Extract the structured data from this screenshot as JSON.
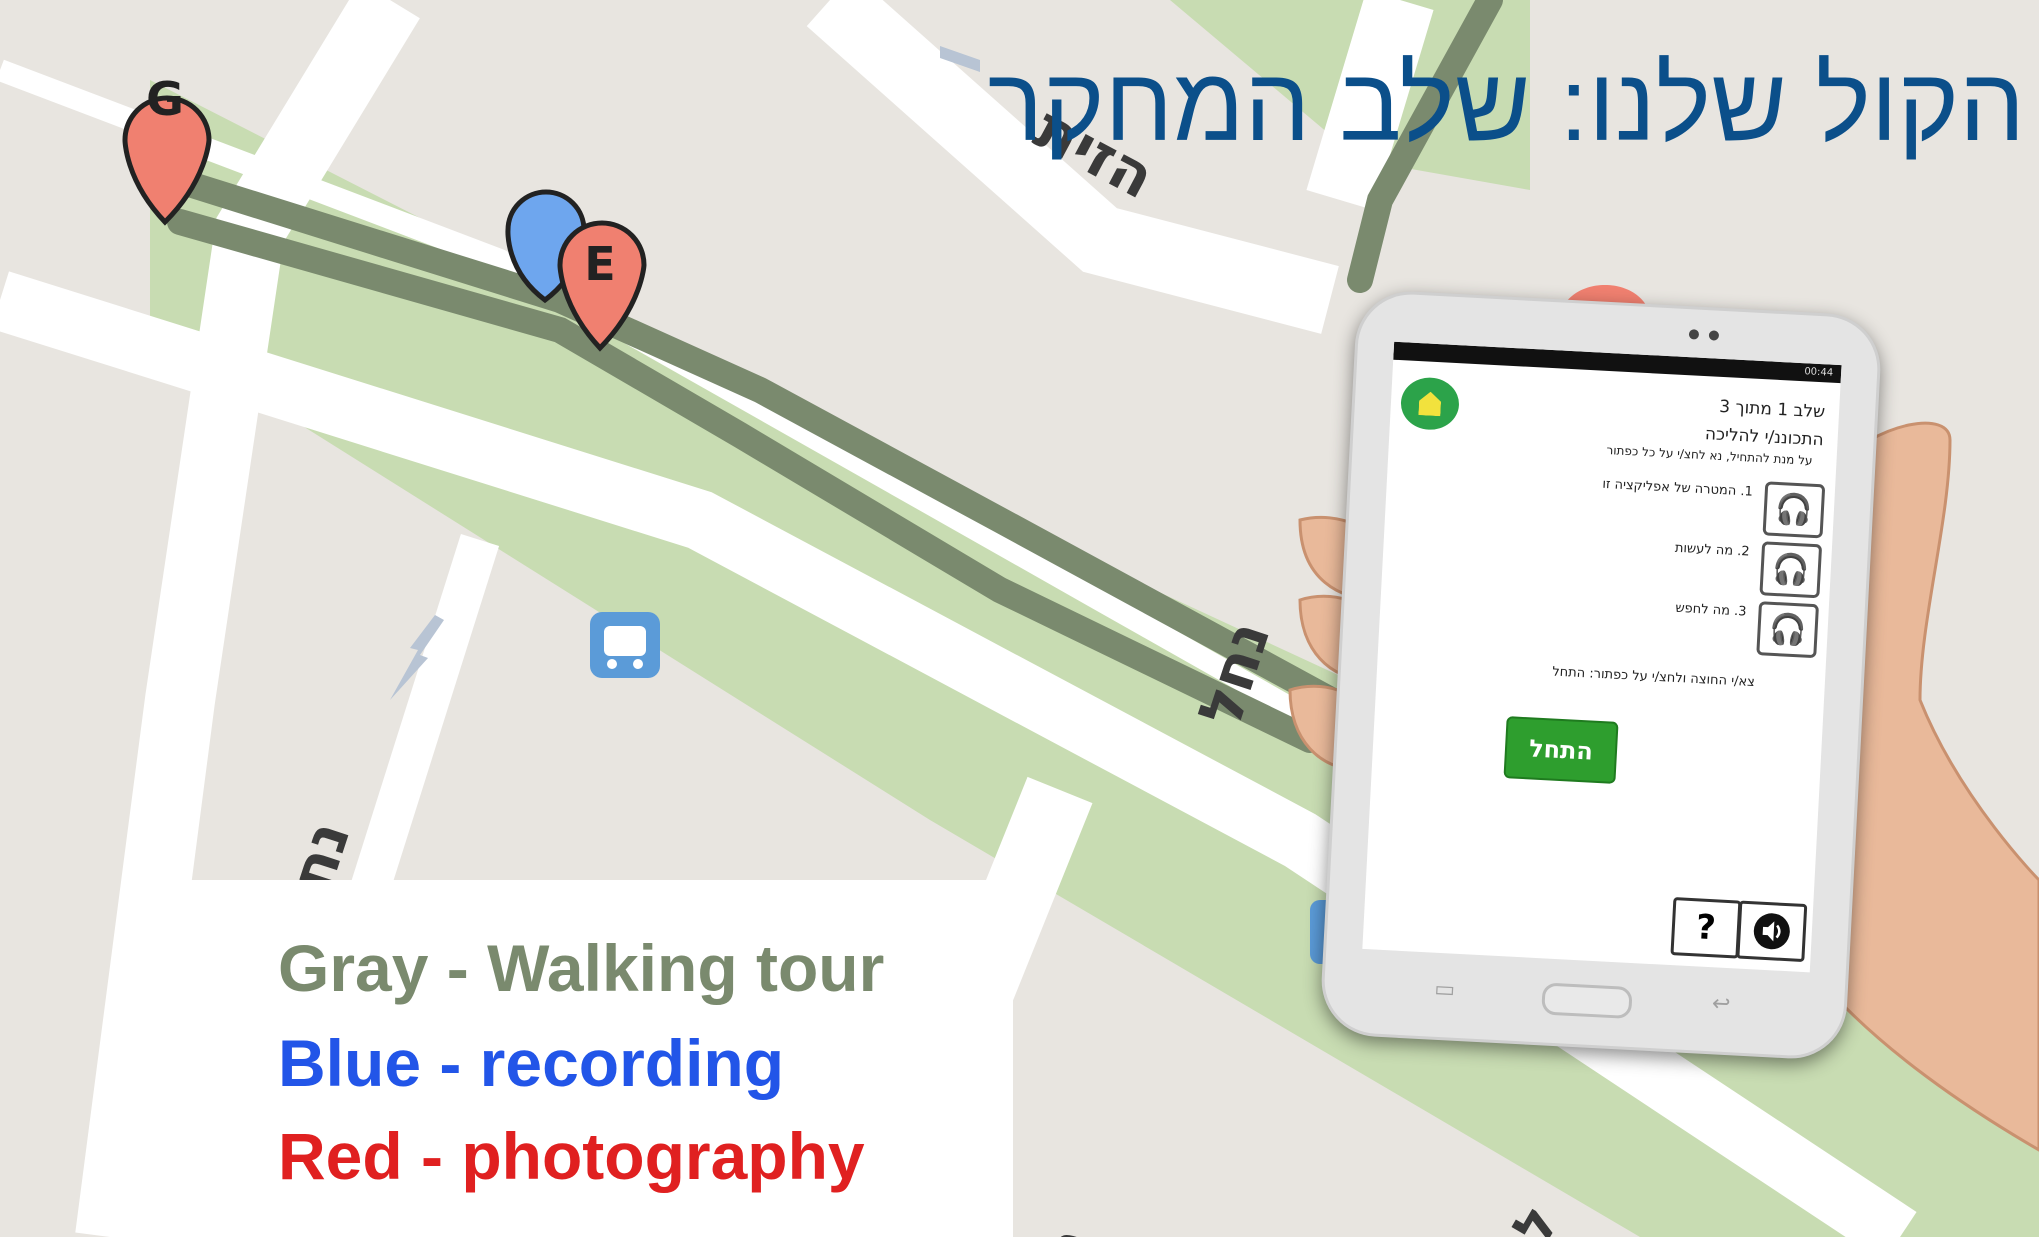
{
  "slide_title": "הקול שלנו: שלב המחקר",
  "map": {
    "streets": {
      "hazait": "הזית",
      "nachal_center": "נחל",
      "nachal_left": "נח\"ל",
      "gad_bottom": "גד",
      "el_bottom": "ל"
    },
    "markers": [
      {
        "letter": "G",
        "color": "#f08070"
      },
      {
        "letter": "E",
        "color": "#f08070"
      }
    ],
    "colors": {
      "background": "#e8e5e0",
      "park": "#c8dcb2",
      "road": "#ffffff",
      "track": "#7a8a6e",
      "bus": "#5b9bd8",
      "blue_pin": "#6ea6ee"
    }
  },
  "legend": {
    "gray": {
      "text": "Gray - Walking tour",
      "color": "#7a8a6e"
    },
    "blue": {
      "text": "Blue - recording",
      "color": "#2255e8"
    },
    "red": {
      "text": "Red - photography",
      "color": "#e02020"
    }
  },
  "tablet": {
    "step": "שלב 1 מתוך 3",
    "heading": "התכוננ/י להליכה",
    "intro": "על מנת להתחיל, נא לחצ/י על כל כפתור",
    "items": [
      {
        "text": "1. המטרה של אפליקציה זו"
      },
      {
        "text": "2. מה לעשות"
      },
      {
        "text": "3. מה לחפש"
      }
    ],
    "instruction": "צא/י החוצה ולחצ/י על כפתור: התחל",
    "start_button": "התחל",
    "help_button": "?",
    "status_time": "00:44",
    "accent": "#2e9e2e"
  }
}
